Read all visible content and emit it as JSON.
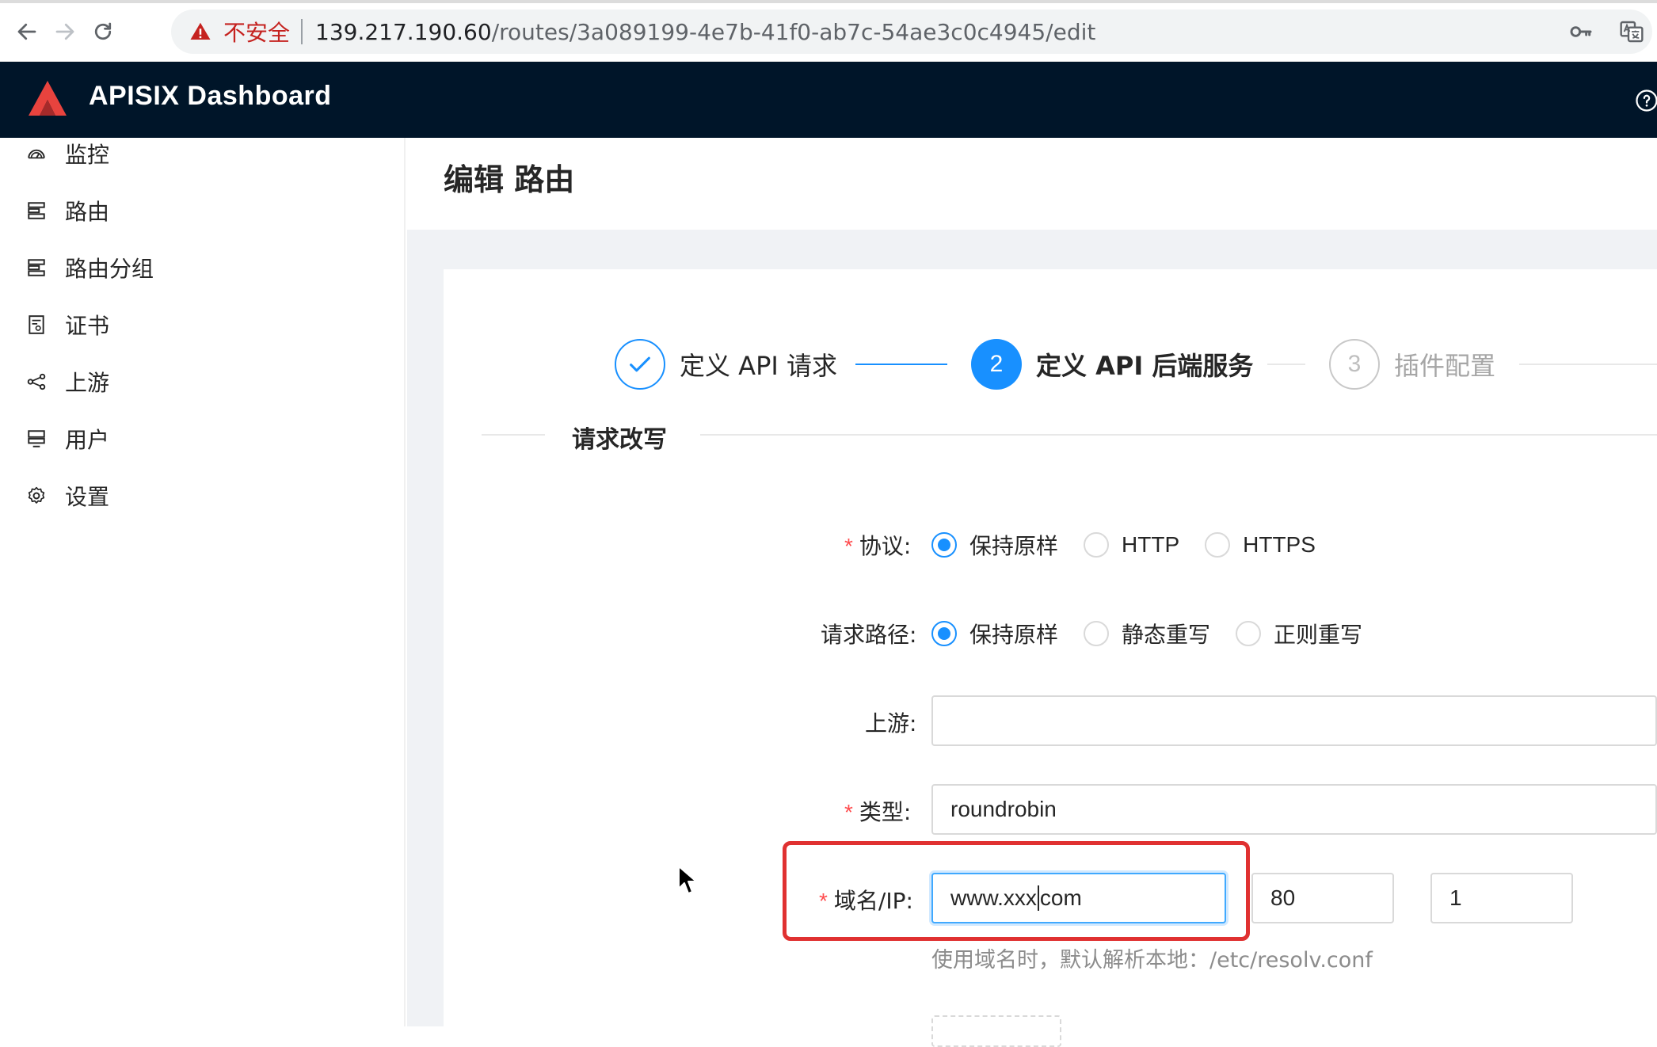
{
  "browser": {
    "insecure_label": "不安全",
    "url_host": "139.217.190.60",
    "url_path": "/routes/3a089199-4e7b-41f0-ab7c-54ae3c0c4945/edit"
  },
  "header": {
    "title": "APISIX Dashboard"
  },
  "sidebar": {
    "items": [
      {
        "label": "监控",
        "icon": "dashboard-icon"
      },
      {
        "label": "路由",
        "icon": "route-icon"
      },
      {
        "label": "路由分组",
        "icon": "route-group-icon"
      },
      {
        "label": "证书",
        "icon": "certificate-icon"
      },
      {
        "label": "上游",
        "icon": "upstream-icon"
      },
      {
        "label": "用户",
        "icon": "user-icon"
      },
      {
        "label": "设置",
        "icon": "gear-icon"
      }
    ]
  },
  "page": {
    "title": "编辑 路由"
  },
  "steps": [
    {
      "number": "1",
      "label": "定义 API 请求",
      "status": "done"
    },
    {
      "number": "2",
      "label": "定义 API 后端服务",
      "status": "active"
    },
    {
      "number": "3",
      "label": "插件配置",
      "status": "wait"
    }
  ],
  "section": {
    "title": "请求改写"
  },
  "form": {
    "protocol": {
      "label": "协议",
      "options": [
        "保持原样",
        "HTTP",
        "HTTPS"
      ],
      "selected": "保持原样"
    },
    "request_path": {
      "label": "请求路径",
      "options": [
        "保持原样",
        "静态重写",
        "正则重写"
      ],
      "selected": "保持原样"
    },
    "upstream": {
      "label": "上游",
      "value": ""
    },
    "type": {
      "label": "类型",
      "value": "roundrobin"
    },
    "host": {
      "label": "域名/IP",
      "value_before_caret": "www.xxx",
      "value_after_caret": "com",
      "port": "80",
      "weight": "1",
      "help": "使用域名时，默认解析本地：/etc/resolv.conf"
    }
  },
  "colors": {
    "primary": "#1890ff",
    "header_bg": "#001529",
    "required": "#ff4d4f",
    "highlight": "#e03131"
  }
}
